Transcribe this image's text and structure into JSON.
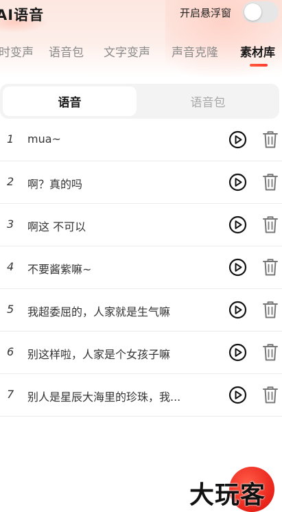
{
  "header": {
    "app_title": "AI语音",
    "float_window_label": "开启悬浮窗",
    "float_window_enabled": false
  },
  "tabs": [
    {
      "label": "时变声",
      "active": false
    },
    {
      "label": "语音包",
      "active": false
    },
    {
      "label": "文字变声",
      "active": false
    },
    {
      "label": "声音克隆",
      "active": false
    },
    {
      "label": "素材库",
      "active": true
    }
  ],
  "segments": [
    {
      "label": "语音",
      "active": true
    },
    {
      "label": "语音包",
      "active": false
    }
  ],
  "items": [
    {
      "index": "1",
      "text": "mua~"
    },
    {
      "index": "2",
      "text": "啊？真的吗"
    },
    {
      "index": "3",
      "text": "啊这 不可以"
    },
    {
      "index": "4",
      "text": "不要酱紫嘛~"
    },
    {
      "index": "5",
      "text": "我超委屈的，人家就是生气嘛"
    },
    {
      "index": "6",
      "text": "别这样啦，人家是个女孩子嘛"
    },
    {
      "index": "7",
      "text": "别人是星辰大海里的珍珠，我..."
    }
  ],
  "icons": {
    "play": "play-circle-icon",
    "delete": "trash-icon"
  },
  "watermark": "大玩客",
  "colors": {
    "accent": "#ff3b30",
    "header_tint": "#fde7e0"
  }
}
